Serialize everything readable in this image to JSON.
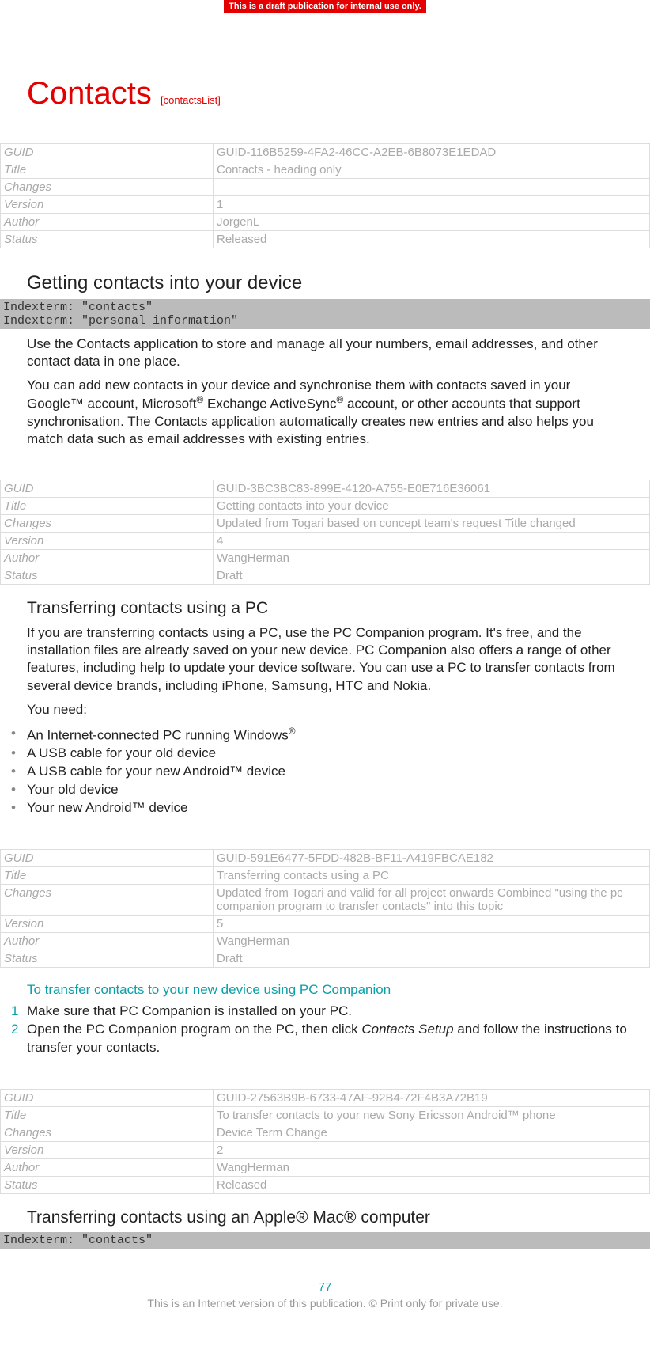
{
  "banner": "This is a draft publication for internal use only.",
  "title": "Contacts",
  "titleId": "[contactsList]",
  "meta1": {
    "guidLabel": "GUID",
    "guid": "GUID-116B5259-4FA2-46CC-A2EB-6B8073E1EDAD",
    "titleLabel": "Title",
    "title": "Contacts - heading only",
    "changesLabel": "Changes",
    "changes": "",
    "versionLabel": "Version",
    "version": "1",
    "authorLabel": "Author",
    "author": "JorgenL",
    "statusLabel": "Status",
    "status": "Released"
  },
  "section1": {
    "heading": "Getting contacts into your device",
    "indexterm1": "Indexterm: \"contacts\"",
    "indexterm2": "Indexterm: \"personal information\"",
    "p1": "Use the Contacts application to store and manage all your numbers, email addresses, and other contact data in one place.",
    "p2a": "You can add new contacts in your device and synchronise them with contacts saved in your Google™ account, Microsoft",
    "p2b": " Exchange ActiveSync",
    "p2c": " account, or other accounts that support synchronisation. The Contacts application automatically creates new entries and also helps you match data such as email addresses with existing entries."
  },
  "meta2": {
    "guidLabel": "GUID",
    "guid": "GUID-3BC3BC83-899E-4120-A755-E0E716E36061",
    "titleLabel": "Title",
    "title": "Getting contacts into your device",
    "changesLabel": "Changes",
    "changes": "Updated from Togari based on concept team's request Title changed",
    "versionLabel": "Version",
    "version": "4",
    "authorLabel": "Author",
    "author": "WangHerman",
    "statusLabel": "Status",
    "status": "Draft"
  },
  "section2": {
    "heading": "Transferring contacts using a PC",
    "p1": "If you are transferring contacts using a PC, use the PC Companion program. It's free, and the installation files are already saved on your new device. PC Companion also offers a range of other features, including help to update your device software. You can use a PC to transfer contacts from several device brands, including iPhone, Samsung, HTC and Nokia.",
    "p2": "You need:",
    "bullets": {
      "b1a": "An Internet-connected PC running Windows",
      "b1sup": "®",
      "b2": "A USB cable for your old device",
      "b3": "A USB cable for your new Android™ device",
      "b4": "Your old device",
      "b5": "Your new Android™ device"
    }
  },
  "meta3": {
    "guidLabel": "GUID",
    "guid": "GUID-591E6477-5FDD-482B-BF11-A419FBCAE182",
    "titleLabel": "Title",
    "title": "Transferring contacts using a PC",
    "changesLabel": "Changes",
    "changes": "Updated from Togari and valid for all project onwards Combined \"using the pc companion program to transfer contacts\" into this topic",
    "versionLabel": "Version",
    "version": "5",
    "authorLabel": "Author",
    "author": "WangHerman",
    "statusLabel": "Status",
    "status": "Draft"
  },
  "proc": {
    "heading": "To transfer contacts to your new device using PC Companion",
    "step1": "Make sure that PC Companion is installed on your PC.",
    "step2a": "Open the PC Companion program on the PC, then click ",
    "step2italic": "Contacts Setup",
    "step2b": " and follow the instructions to transfer your contacts."
  },
  "meta4": {
    "guidLabel": "GUID",
    "guid": "GUID-27563B9B-6733-47AF-92B4-72F4B3A72B19",
    "titleLabel": "Title",
    "title": "To transfer contacts to your new Sony Ericsson Android™ phone",
    "changesLabel": "Changes",
    "changes": "Device Term Change",
    "versionLabel": "Version",
    "version": "2",
    "authorLabel": "Author",
    "author": "WangHerman",
    "statusLabel": "Status",
    "status": "Released"
  },
  "section3": {
    "heading": "Transferring contacts using an Apple® Mac® computer",
    "indexterm1": "Indexterm: \"contacts\""
  },
  "pageNumber": "77",
  "footer": "This is an Internet version of this publication. © Print only for private use."
}
